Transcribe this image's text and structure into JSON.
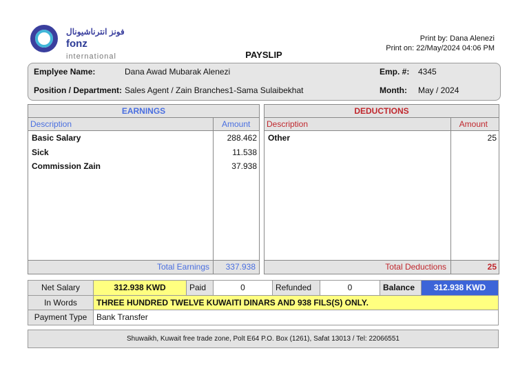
{
  "logo": {
    "arabic": "فونز انترناشيونال",
    "brand": "fonz",
    "suffix": "international"
  },
  "title": "PAYSLIP",
  "print_by": "Print by: Dana Alenezi",
  "print_on": "Print on: 22/May/2024 04:06 PM",
  "employee": {
    "name_label": "Emplyee Name:",
    "name": "Dana Awad Mubarak Alenezi",
    "position_label": "Position / Department:",
    "position": "Sales Agent / Zain Branches1-Sama Sulaibekhat",
    "emp_label": "Emp. #:",
    "emp_no": "4345",
    "month_label": "Month:",
    "month": "May / 2024"
  },
  "earnings": {
    "title": "EARNINGS",
    "desc_label": "Description",
    "amount_label": "Amount",
    "items": [
      {
        "desc": "Basic Salary",
        "amount": "288.462"
      },
      {
        "desc": "Sick",
        "amount": "11.538"
      },
      {
        "desc": "Commission Zain",
        "amount": "37.938"
      }
    ],
    "total_label": "Total Earnings",
    "total": "337.938"
  },
  "deductions": {
    "title": "DEDUCTIONS",
    "desc_label": "Description",
    "amount_label": "Amount",
    "items": [
      {
        "desc": "Other",
        "amount": "25"
      }
    ],
    "total_label": "Total Deductions",
    "total": "25"
  },
  "summary": {
    "net_label": "Net Salary",
    "net": "312.938 KWD",
    "paid_label": "Paid",
    "paid": "0",
    "refunded_label": "Refunded",
    "refunded": "0",
    "balance_label": "Balance",
    "balance": "312.938 KWD",
    "words_label": "In Words",
    "words": "THREE HUNDRED TWELVE KUWAITI DINARS AND 938 FILS(S) ONLY.",
    "payment_label": "Payment Type",
    "payment": "Bank Transfer"
  },
  "footer": "Shuwaikh, Kuwait free trade zone, Polt E64 P.O. Box (1261), Safat 13013 / Tel: 22066551",
  "colors": {
    "blue": "#4a6fe0",
    "red": "#c0272d",
    "yellow": "#ffff80",
    "balance_bg": "#3c64d8"
  }
}
